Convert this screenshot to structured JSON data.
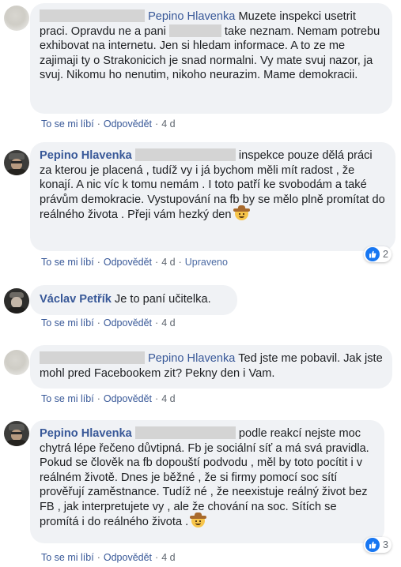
{
  "comments": [
    {
      "author": "Pepino Hlavenka",
      "text_a": " Muzete inspekci usetrit praci. Opravdu ne a pani ",
      "text_b": " take neznam. Nemam potrebu exhibovat na internetu. Jen si hledam informace. A to ze me zajimaji ty o Strakonicich je snad normalni. Vy mate svuj nazor, ja svuj. Nikomu ho nenutim, nikoho neurazim. Mame demokracii.",
      "like": "To se mi líbí",
      "reply": "Odpovědět",
      "time": "4 d"
    },
    {
      "author": "Pepino Hlavenka",
      "text": " inspekce pouze dělá práci za kterou je placená , tudíž vy i já bychom měli mít radost , že konají. A nic víc k tomu nemám . I toto patří ke svobodám a také právům demokracie. Vystupování na fb by se mělo plně promítat do reálného života . Přeji vám hezký den",
      "emoji": "cowboy-emoji",
      "like": "To se mi líbí",
      "reply": "Odpovědět",
      "time": "4 d",
      "edited": "Upraveno",
      "reaction_count": "2"
    },
    {
      "author": "Václav Petřík",
      "text": " Je to paní učitelka.",
      "like": "To se mi líbí",
      "reply": "Odpovědět",
      "time": "4 d"
    },
    {
      "author": "Pepino Hlavenka",
      "text": " Ted jste me pobavil. Jak jste mohl pred Facebookem zit? Pekny den i Vam.",
      "like": "To se mi líbí",
      "reply": "Odpovědět",
      "time": "4 d"
    },
    {
      "author": "Pepino Hlavenka",
      "text": " podle reakcí nejste moc chytrá lépe řečeno důvtipná. Fb je sociální síť a má svá pravidla. Pokud se člověk na fb dopouští podvodu , měl by toto pocítit i v reálném životě. Dnes je běžné , že si firmy pomocí soc sítí prověřují zaměstnance. Tudíž né , že neexistuje reálný život bez FB , jak interpretujete vy , ale že chování na soc. Sítích se promítá i do reálného života .",
      "emoji": "cowboy-emoji",
      "like": "To se mi líbí",
      "reply": "Odpovědět",
      "time": "4 d",
      "reaction_count": "3"
    }
  ],
  "colors": {
    "bubble": "#f0f2f5",
    "author": "#385898",
    "like_blue": "#1877f2",
    "meta": "#606770"
  },
  "separator": "·"
}
